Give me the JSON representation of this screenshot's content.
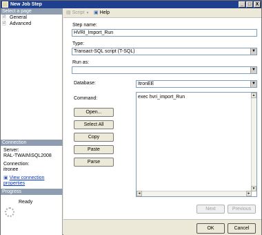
{
  "window": {
    "title": "New Job Step",
    "controls": [
      "_",
      "□",
      "X"
    ]
  },
  "left_pane": {
    "select_page_header": "Select a page",
    "pages": [
      {
        "label": "General",
        "icon": "page-icon"
      },
      {
        "label": "Advanced",
        "icon": "page-icon"
      }
    ],
    "connection_header": "Connection",
    "server_label": "Server:",
    "server_value": "RAL-TWAIN\\SQL2008",
    "connection_label": "Connection:",
    "connection_value": "itronee",
    "view_connection_link": "View connection properties",
    "progress_header": "Progress",
    "progress_status": "Ready"
  },
  "toolbar": {
    "script_label": "Script",
    "script_arrow": "▼",
    "help_label": "Help"
  },
  "form": {
    "step_name_label": "Step name:",
    "step_name_value": "HVRI_Import_Run",
    "type_label": "Type:",
    "type_value": "Transact-SQL script (T-SQL)",
    "run_as_label": "Run as:",
    "run_as_value": "",
    "database_label": "Database:",
    "database_value": "ItronEE",
    "command_label": "Command:",
    "command_value": "exec hvri_import_Run"
  },
  "buttons": {
    "open": "Open...",
    "select_all": "Select All",
    "copy": "Copy",
    "paste": "Paste",
    "parse": "Parse",
    "next": "Next",
    "previous": "Previous",
    "ok": "OK",
    "cancel": "Cancel"
  },
  "scroll": {
    "up": "▲",
    "down": "▼",
    "left": "◄",
    "right": "►"
  },
  "combo_arrow": "▼",
  "colors": {
    "title_bar": "#1f3f8f",
    "pane_header": "#8f9db0",
    "link": "#0033cc"
  }
}
